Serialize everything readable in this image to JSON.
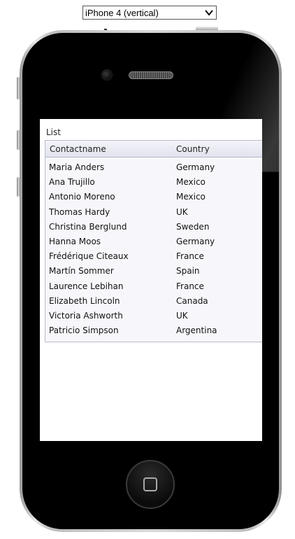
{
  "device_selector": {
    "selected": "iPhone 4 (vertical)"
  },
  "list": {
    "title": "List",
    "columns": [
      "Contactname",
      "Country"
    ],
    "rows": [
      {
        "name": "Maria Anders",
        "country": "Germany"
      },
      {
        "name": "Ana Trujillo",
        "country": "Mexico"
      },
      {
        "name": "Antonio Moreno",
        "country": "Mexico"
      },
      {
        "name": "Thomas Hardy",
        "country": "UK"
      },
      {
        "name": "Christina Berglund",
        "country": "Sweden"
      },
      {
        "name": "Hanna Moos",
        "country": "Germany"
      },
      {
        "name": "Frédérique Citeaux",
        "country": "France"
      },
      {
        "name": "Martín Sommer",
        "country": "Spain"
      },
      {
        "name": "Laurence Lebihan",
        "country": "France"
      },
      {
        "name": "Elizabeth Lincoln",
        "country": "Canada"
      },
      {
        "name": "Victoria Ashworth",
        "country": "UK"
      },
      {
        "name": "Patricio Simpson",
        "country": "Argentina"
      }
    ]
  },
  "colors": {
    "header_bg": "#e2e3ef",
    "grid_bg": "#f7f7fb",
    "phone_body": "#000000"
  },
  "icons": {
    "dropdown": "chevron-down-icon",
    "home": "home-button-icon"
  }
}
